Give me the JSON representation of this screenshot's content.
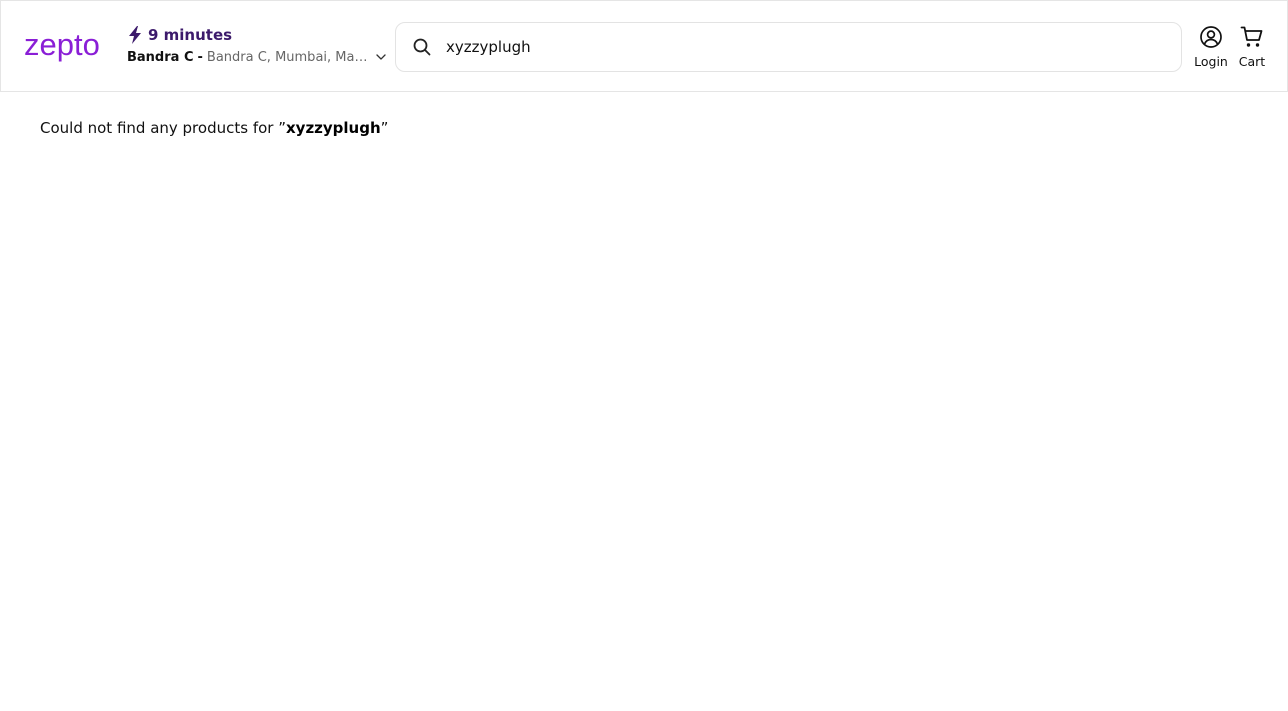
{
  "header": {
    "logo": {
      "text": "zepto",
      "color": "#8a1ed6"
    },
    "delivery": {
      "eta": "9 minutes",
      "area": "Bandra C",
      "separator": "-",
      "full_address": "Bandra C, Mumbai, Maharashtra"
    },
    "search": {
      "value": "xyzzyplugh"
    },
    "login_label": "Login",
    "cart_label": "Cart"
  },
  "results": {
    "message_prefix": "Could not find any products for ”",
    "query": "xyzzyplugh",
    "message_suffix": "”"
  },
  "colors": {
    "brand": "#8a1ed6",
    "eta": "#3c1a6b",
    "address_muted": "#666666"
  }
}
